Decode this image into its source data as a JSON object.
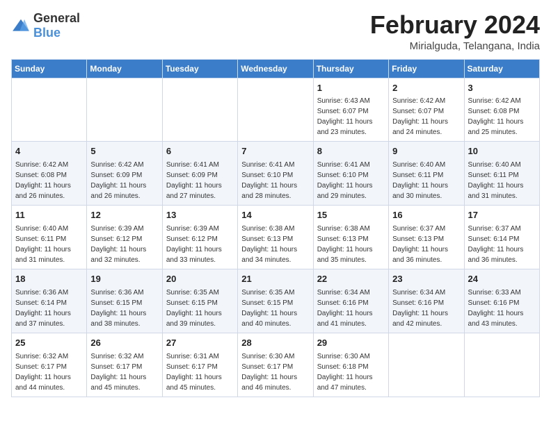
{
  "logo": {
    "text_general": "General",
    "text_blue": "Blue"
  },
  "title": {
    "month": "February 2024",
    "location": "Mirialguda, Telangana, India"
  },
  "days_of_week": [
    "Sunday",
    "Monday",
    "Tuesday",
    "Wednesday",
    "Thursday",
    "Friday",
    "Saturday"
  ],
  "weeks": [
    [
      {
        "day": "",
        "info": ""
      },
      {
        "day": "",
        "info": ""
      },
      {
        "day": "",
        "info": ""
      },
      {
        "day": "",
        "info": ""
      },
      {
        "day": "1",
        "info": "Sunrise: 6:43 AM\nSunset: 6:07 PM\nDaylight: 11 hours\nand 23 minutes."
      },
      {
        "day": "2",
        "info": "Sunrise: 6:42 AM\nSunset: 6:07 PM\nDaylight: 11 hours\nand 24 minutes."
      },
      {
        "day": "3",
        "info": "Sunrise: 6:42 AM\nSunset: 6:08 PM\nDaylight: 11 hours\nand 25 minutes."
      }
    ],
    [
      {
        "day": "4",
        "info": "Sunrise: 6:42 AM\nSunset: 6:08 PM\nDaylight: 11 hours\nand 26 minutes."
      },
      {
        "day": "5",
        "info": "Sunrise: 6:42 AM\nSunset: 6:09 PM\nDaylight: 11 hours\nand 26 minutes."
      },
      {
        "day": "6",
        "info": "Sunrise: 6:41 AM\nSunset: 6:09 PM\nDaylight: 11 hours\nand 27 minutes."
      },
      {
        "day": "7",
        "info": "Sunrise: 6:41 AM\nSunset: 6:10 PM\nDaylight: 11 hours\nand 28 minutes."
      },
      {
        "day": "8",
        "info": "Sunrise: 6:41 AM\nSunset: 6:10 PM\nDaylight: 11 hours\nand 29 minutes."
      },
      {
        "day": "9",
        "info": "Sunrise: 6:40 AM\nSunset: 6:11 PM\nDaylight: 11 hours\nand 30 minutes."
      },
      {
        "day": "10",
        "info": "Sunrise: 6:40 AM\nSunset: 6:11 PM\nDaylight: 11 hours\nand 31 minutes."
      }
    ],
    [
      {
        "day": "11",
        "info": "Sunrise: 6:40 AM\nSunset: 6:11 PM\nDaylight: 11 hours\nand 31 minutes."
      },
      {
        "day": "12",
        "info": "Sunrise: 6:39 AM\nSunset: 6:12 PM\nDaylight: 11 hours\nand 32 minutes."
      },
      {
        "day": "13",
        "info": "Sunrise: 6:39 AM\nSunset: 6:12 PM\nDaylight: 11 hours\nand 33 minutes."
      },
      {
        "day": "14",
        "info": "Sunrise: 6:38 AM\nSunset: 6:13 PM\nDaylight: 11 hours\nand 34 minutes."
      },
      {
        "day": "15",
        "info": "Sunrise: 6:38 AM\nSunset: 6:13 PM\nDaylight: 11 hours\nand 35 minutes."
      },
      {
        "day": "16",
        "info": "Sunrise: 6:37 AM\nSunset: 6:13 PM\nDaylight: 11 hours\nand 36 minutes."
      },
      {
        "day": "17",
        "info": "Sunrise: 6:37 AM\nSunset: 6:14 PM\nDaylight: 11 hours\nand 36 minutes."
      }
    ],
    [
      {
        "day": "18",
        "info": "Sunrise: 6:36 AM\nSunset: 6:14 PM\nDaylight: 11 hours\nand 37 minutes."
      },
      {
        "day": "19",
        "info": "Sunrise: 6:36 AM\nSunset: 6:15 PM\nDaylight: 11 hours\nand 38 minutes."
      },
      {
        "day": "20",
        "info": "Sunrise: 6:35 AM\nSunset: 6:15 PM\nDaylight: 11 hours\nand 39 minutes."
      },
      {
        "day": "21",
        "info": "Sunrise: 6:35 AM\nSunset: 6:15 PM\nDaylight: 11 hours\nand 40 minutes."
      },
      {
        "day": "22",
        "info": "Sunrise: 6:34 AM\nSunset: 6:16 PM\nDaylight: 11 hours\nand 41 minutes."
      },
      {
        "day": "23",
        "info": "Sunrise: 6:34 AM\nSunset: 6:16 PM\nDaylight: 11 hours\nand 42 minutes."
      },
      {
        "day": "24",
        "info": "Sunrise: 6:33 AM\nSunset: 6:16 PM\nDaylight: 11 hours\nand 43 minutes."
      }
    ],
    [
      {
        "day": "25",
        "info": "Sunrise: 6:32 AM\nSunset: 6:17 PM\nDaylight: 11 hours\nand 44 minutes."
      },
      {
        "day": "26",
        "info": "Sunrise: 6:32 AM\nSunset: 6:17 PM\nDaylight: 11 hours\nand 45 minutes."
      },
      {
        "day": "27",
        "info": "Sunrise: 6:31 AM\nSunset: 6:17 PM\nDaylight: 11 hours\nand 45 minutes."
      },
      {
        "day": "28",
        "info": "Sunrise: 6:30 AM\nSunset: 6:17 PM\nDaylight: 11 hours\nand 46 minutes."
      },
      {
        "day": "29",
        "info": "Sunrise: 6:30 AM\nSunset: 6:18 PM\nDaylight: 11 hours\nand 47 minutes."
      },
      {
        "day": "",
        "info": ""
      },
      {
        "day": "",
        "info": ""
      }
    ]
  ]
}
